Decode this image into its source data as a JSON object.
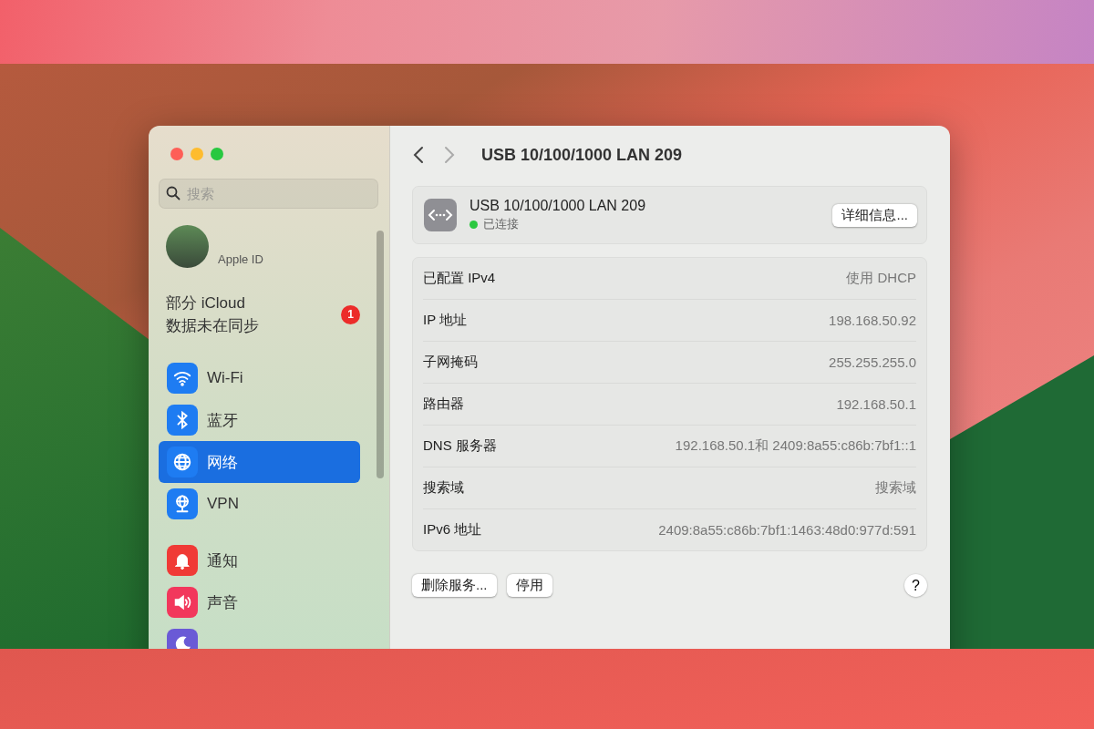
{
  "sidebar": {
    "search": {
      "placeholder": "搜索"
    },
    "account": {
      "label": "Apple ID"
    },
    "alert": {
      "text": "部分 iCloud\n数据未在同步",
      "badge": "1"
    },
    "groups": [
      [
        {
          "kind": "wifi",
          "label": "Wi-Fi",
          "color": "#1e7cf2",
          "selected": false
        },
        {
          "kind": "bluetooth",
          "label": "蓝牙",
          "color": "#1e7cf2",
          "selected": false
        },
        {
          "kind": "network",
          "label": "网络",
          "color": "#1e7cf2",
          "selected": true
        },
        {
          "kind": "vpn",
          "label": "VPN",
          "color": "#1e7cf2",
          "selected": false
        }
      ],
      [
        {
          "kind": "bell",
          "label": "通知",
          "color": "#f03a36",
          "selected": false
        },
        {
          "kind": "sound",
          "label": "声音",
          "color": "#f2375c",
          "selected": false
        },
        {
          "kind": "moon",
          "color": "#6a5ad6",
          "selected": false
        }
      ]
    ]
  },
  "header": {
    "title": "USB 10/100/1000 LAN 209"
  },
  "service": {
    "name": "USB 10/100/1000 LAN 209",
    "status": "已连接",
    "connected": true,
    "details_button": "详细信息..."
  },
  "rows": [
    {
      "label": "已配置 IPv4",
      "value": "使用 DHCP"
    },
    {
      "label": "IP 地址",
      "value": "198.168.50.92"
    },
    {
      "label": "子网掩码",
      "value": "255.255.255.0"
    },
    {
      "label": "路由器",
      "value": "192.168.50.1"
    },
    {
      "label": "DNS 服务器",
      "value": "192.168.50.1和 2409:8a55:c86b:7bf1::1"
    },
    {
      "label": "搜索域",
      "value": "搜索域"
    },
    {
      "label": "IPv6 地址",
      "value": "2409:8a55:c86b:7bf1:1463:48d0:977d:591"
    }
  ],
  "footer": {
    "buttons": [
      "删除服务...",
      "停用"
    ],
    "help": "?"
  }
}
